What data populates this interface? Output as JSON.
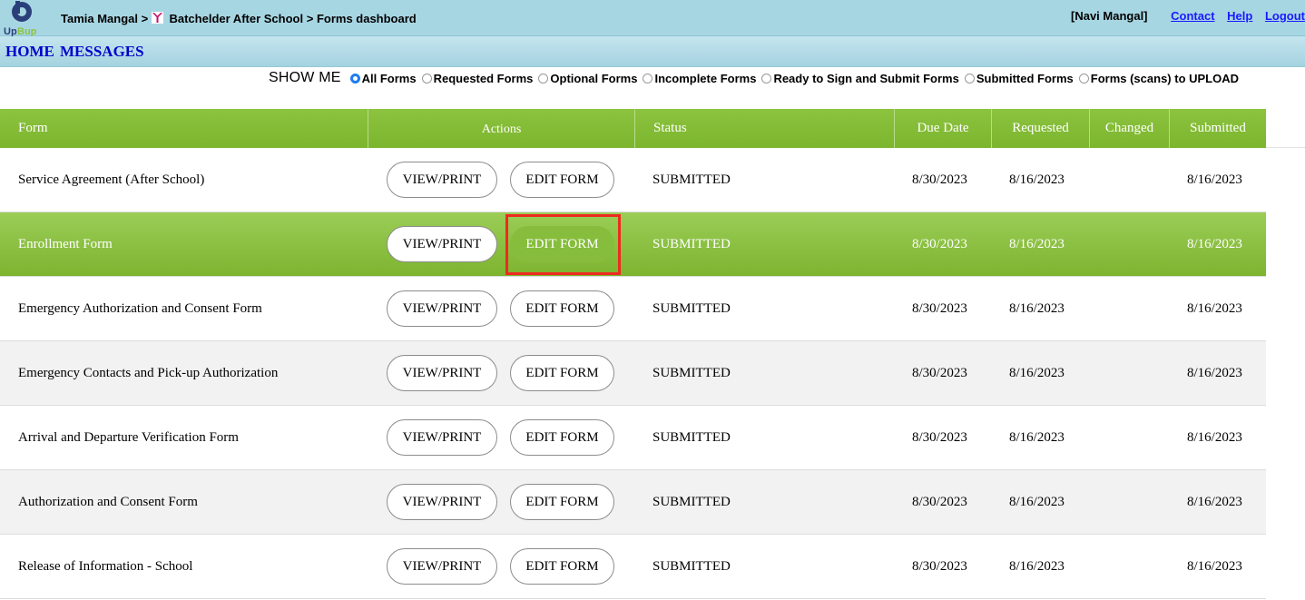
{
  "header": {
    "logo_text": "UpBup",
    "crumb_user": "Tamia Mangal",
    "crumb_sep": ">",
    "crumb_program": "Batchelder After School",
    "crumb_page": "Forms dashboard",
    "account_name": "[Navi Mangal]",
    "links": [
      "Contact",
      "Help",
      "Logout"
    ]
  },
  "nav": {
    "home": "HOME",
    "messages": "MESSAGES"
  },
  "filters": {
    "label": "SHOW ME",
    "options": [
      {
        "label": "All Forms",
        "checked": true
      },
      {
        "label": "Requested Forms",
        "checked": false
      },
      {
        "label": "Optional Forms",
        "checked": false
      },
      {
        "label": "Incomplete Forms",
        "checked": false
      },
      {
        "label": "Ready to Sign and Submit Forms",
        "checked": false
      },
      {
        "label": "Submitted Forms",
        "checked": false
      },
      {
        "label": "Forms (scans) to UPLOAD",
        "checked": false
      }
    ]
  },
  "table": {
    "columns": [
      "Form",
      "Actions",
      "Status",
      "Due Date",
      "Requested",
      "Changed",
      "Submitted"
    ],
    "view_label": "VIEW/PRINT",
    "edit_label": "EDIT FORM",
    "rows": [
      {
        "form": "Service Agreement (After School)",
        "status": "SUBMITTED",
        "due": "8/30/2023",
        "requested": "8/16/2023",
        "changed": "",
        "submitted": "8/16/2023"
      },
      {
        "form": "Enrollment Form",
        "status": "SUBMITTED",
        "due": "8/30/2023",
        "requested": "8/16/2023",
        "changed": "",
        "submitted": "8/16/2023"
      },
      {
        "form": "Emergency Authorization and Consent Form",
        "status": "SUBMITTED",
        "due": "8/30/2023",
        "requested": "8/16/2023",
        "changed": "",
        "submitted": "8/16/2023"
      },
      {
        "form": "Emergency Contacts and Pick-up Authorization",
        "status": "SUBMITTED",
        "due": "8/30/2023",
        "requested": "8/16/2023",
        "changed": "",
        "submitted": "8/16/2023"
      },
      {
        "form": "Arrival and Departure Verification Form",
        "status": "SUBMITTED",
        "due": "8/30/2023",
        "requested": "8/16/2023",
        "changed": "",
        "submitted": "8/16/2023"
      },
      {
        "form": "Authorization and Consent Form",
        "status": "SUBMITTED",
        "due": "8/30/2023",
        "requested": "8/16/2023",
        "changed": "",
        "submitted": "8/16/2023"
      },
      {
        "form": "Release of Information - School",
        "status": "SUBMITTED",
        "due": "8/30/2023",
        "requested": "8/16/2023",
        "changed": "",
        "submitted": "8/16/2023"
      }
    ]
  },
  "colors": {
    "header_bg": "#a7d6e3",
    "table_header_green": "#7cb52e",
    "selected_row_green": "#8cc33f",
    "link_blue": "#1a1aff",
    "highlight_red": "#ee2a1f"
  }
}
